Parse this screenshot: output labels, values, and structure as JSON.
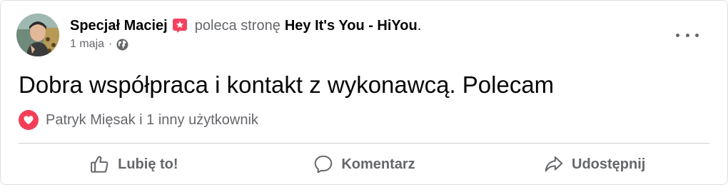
{
  "post": {
    "author": "Specjał Maciej",
    "action_verb": "poleca stronę",
    "page_name": "Hey It's You - HiYou",
    "page_name_suffix": ".",
    "date": "1 maja",
    "separator": "·",
    "visibility_icon": "globe-icon",
    "body": "Dobra współpraca i kontakt z wykonawcą. Polecam",
    "more_icon": "more-options-icon"
  },
  "reactions": {
    "icon": "heart-icon",
    "summary": "Patryk Mięsak i 1 inny użytkownik"
  },
  "actions": {
    "like": {
      "label": "Lubię to!",
      "icon": "thumbs-up-icon"
    },
    "comment": {
      "label": "Komentarz",
      "icon": "comment-icon"
    },
    "share": {
      "label": "Udostępnij",
      "icon": "share-icon"
    }
  },
  "colors": {
    "text_primary": "#050505",
    "text_secondary": "#65676b",
    "recommend_badge": "#f3425f",
    "love_reaction": "#f33e58",
    "divider": "#ced0d4"
  }
}
